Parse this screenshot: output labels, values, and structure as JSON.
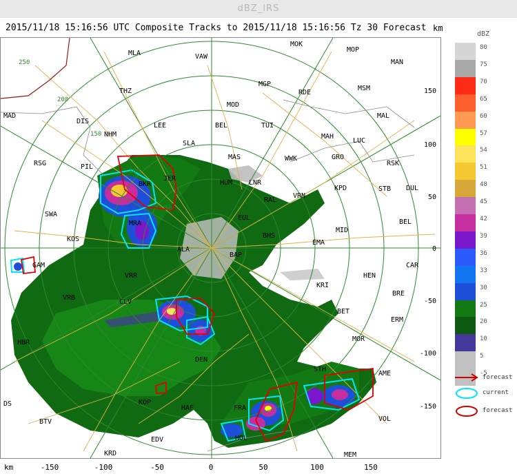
{
  "app": {
    "title": "dBZ_IRS"
  },
  "header": {
    "text": "2015/11/18 15:16:56 UTC Composite Tracks to 2015/11/18 15:16:56 Tz 30 Forecast"
  },
  "map": {
    "unit_label": "km",
    "right_unit_label": "km",
    "x_ticks": [
      "-150",
      "-100",
      "-50",
      "0",
      "50",
      "100",
      "150"
    ],
    "y_ticks": [
      "150",
      "100",
      "50",
      "0",
      "-50",
      "-100",
      "-150"
    ],
    "ring_labels": [
      "250",
      "200",
      "150",
      "100",
      "50"
    ],
    "stations": [
      {
        "name": "MLA"
      },
      {
        "name": "VAW"
      },
      {
        "name": "MOK"
      },
      {
        "name": "MOP"
      },
      {
        "name": "MAN"
      },
      {
        "name": "MGP"
      },
      {
        "name": "THZ"
      },
      {
        "name": "RDE"
      },
      {
        "name": "MSM"
      },
      {
        "name": "MOD"
      },
      {
        "name": "MAL"
      },
      {
        "name": "MAD"
      },
      {
        "name": "DIS"
      },
      {
        "name": "BEL"
      },
      {
        "name": "TUI"
      },
      {
        "name": "MAH"
      },
      {
        "name": "LUC"
      },
      {
        "name": "NHM"
      },
      {
        "name": "LEE"
      },
      {
        "name": "SLA"
      },
      {
        "name": "RSG"
      },
      {
        "name": "MAS"
      },
      {
        "name": "WWK"
      },
      {
        "name": "GRO"
      },
      {
        "name": "RSK"
      },
      {
        "name": "PIL"
      },
      {
        "name": "BKR"
      },
      {
        "name": "JER"
      },
      {
        "name": "HUM"
      },
      {
        "name": "LNR"
      },
      {
        "name": "KPD"
      },
      {
        "name": "STB"
      },
      {
        "name": "DUL"
      },
      {
        "name": "SWA"
      },
      {
        "name": "RAL"
      },
      {
        "name": "VRN"
      },
      {
        "name": "EUL"
      },
      {
        "name": "KOS"
      },
      {
        "name": "MRA"
      },
      {
        "name": "BHS"
      },
      {
        "name": "MID"
      },
      {
        "name": "BEL"
      },
      {
        "name": "EMA"
      },
      {
        "name": "GAM"
      },
      {
        "name": "ALA"
      },
      {
        "name": "BAP"
      },
      {
        "name": "CAR"
      },
      {
        "name": "VRR"
      },
      {
        "name": "HEN"
      },
      {
        "name": "KRI"
      },
      {
        "name": "BRE"
      },
      {
        "name": "CLV"
      },
      {
        "name": "BET"
      },
      {
        "name": "ERM"
      },
      {
        "name": "HBR"
      },
      {
        "name": "MOR"
      },
      {
        "name": "DEN"
      },
      {
        "name": "STH"
      },
      {
        "name": "AME"
      },
      {
        "name": "KOP"
      },
      {
        "name": "HAF"
      },
      {
        "name": "FRA"
      },
      {
        "name": "VOL"
      },
      {
        "name": "BTV"
      },
      {
        "name": "EDV"
      },
      {
        "name": "KRD"
      },
      {
        "name": "MEM"
      },
      {
        "name": "DS"
      },
      {
        "name": "VRB"
      },
      {
        "name": "HOL"
      }
    ]
  },
  "legend": {
    "title": "dBZ",
    "items": [
      {
        "label": "80",
        "color": "#d6d6d6"
      },
      {
        "label": "75",
        "color": "#a9a9a9"
      },
      {
        "label": "70",
        "color": "#ff2a16"
      },
      {
        "label": "65",
        "color": "#ff5f2e"
      },
      {
        "label": "60",
        "color": "#ff9a55"
      },
      {
        "label": "57",
        "color": "#ffff00"
      },
      {
        "label": "54",
        "color": "#fce35a"
      },
      {
        "label": "51",
        "color": "#f5c832"
      },
      {
        "label": "48",
        "color": "#d6a839"
      },
      {
        "label": "45",
        "color": "#c46fb1"
      },
      {
        "label": "42",
        "color": "#c62ea0"
      },
      {
        "label": "39",
        "color": "#7a16cc"
      },
      {
        "label": "36",
        "color": "#2b5bff"
      },
      {
        "label": "33",
        "color": "#1276f2"
      },
      {
        "label": "30",
        "color": "#1e4fd8"
      },
      {
        "label": "25",
        "color": "#137a13"
      },
      {
        "label": "20",
        "color": "#0f5a12"
      },
      {
        "label": "10",
        "color": "#44399a"
      },
      {
        "label": "5",
        "color": "#c0c0c0"
      },
      {
        "label": "-5",
        "color": "#c0c0c0"
      }
    ],
    "symbols": [
      {
        "label": "forecast",
        "kind": "arrow",
        "color": "#d40000"
      },
      {
        "label": "current",
        "kind": "ellipse",
        "color": "#00e5ff"
      },
      {
        "label": "forecast",
        "kind": "ellipse",
        "color": "#d40000"
      }
    ]
  }
}
